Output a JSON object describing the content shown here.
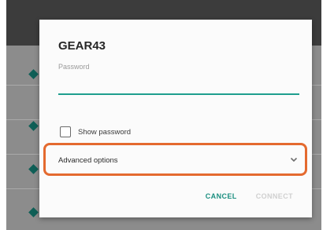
{
  "dialog": {
    "title": "GEAR43",
    "password_label": "Password",
    "password_value": "",
    "show_password_label": "Show password",
    "show_password_checked": false,
    "advanced_options_label": "Advanced options",
    "cancel_label": "CANCEL",
    "connect_label": "CONNECT",
    "connect_enabled": false
  },
  "colors": {
    "accent": "#1e9e8e",
    "highlight": "#e46a2f",
    "scrim": "#8c8c8c"
  },
  "icons": {
    "expand": "chevron-down-icon",
    "network": "wifi-signal-icon"
  }
}
